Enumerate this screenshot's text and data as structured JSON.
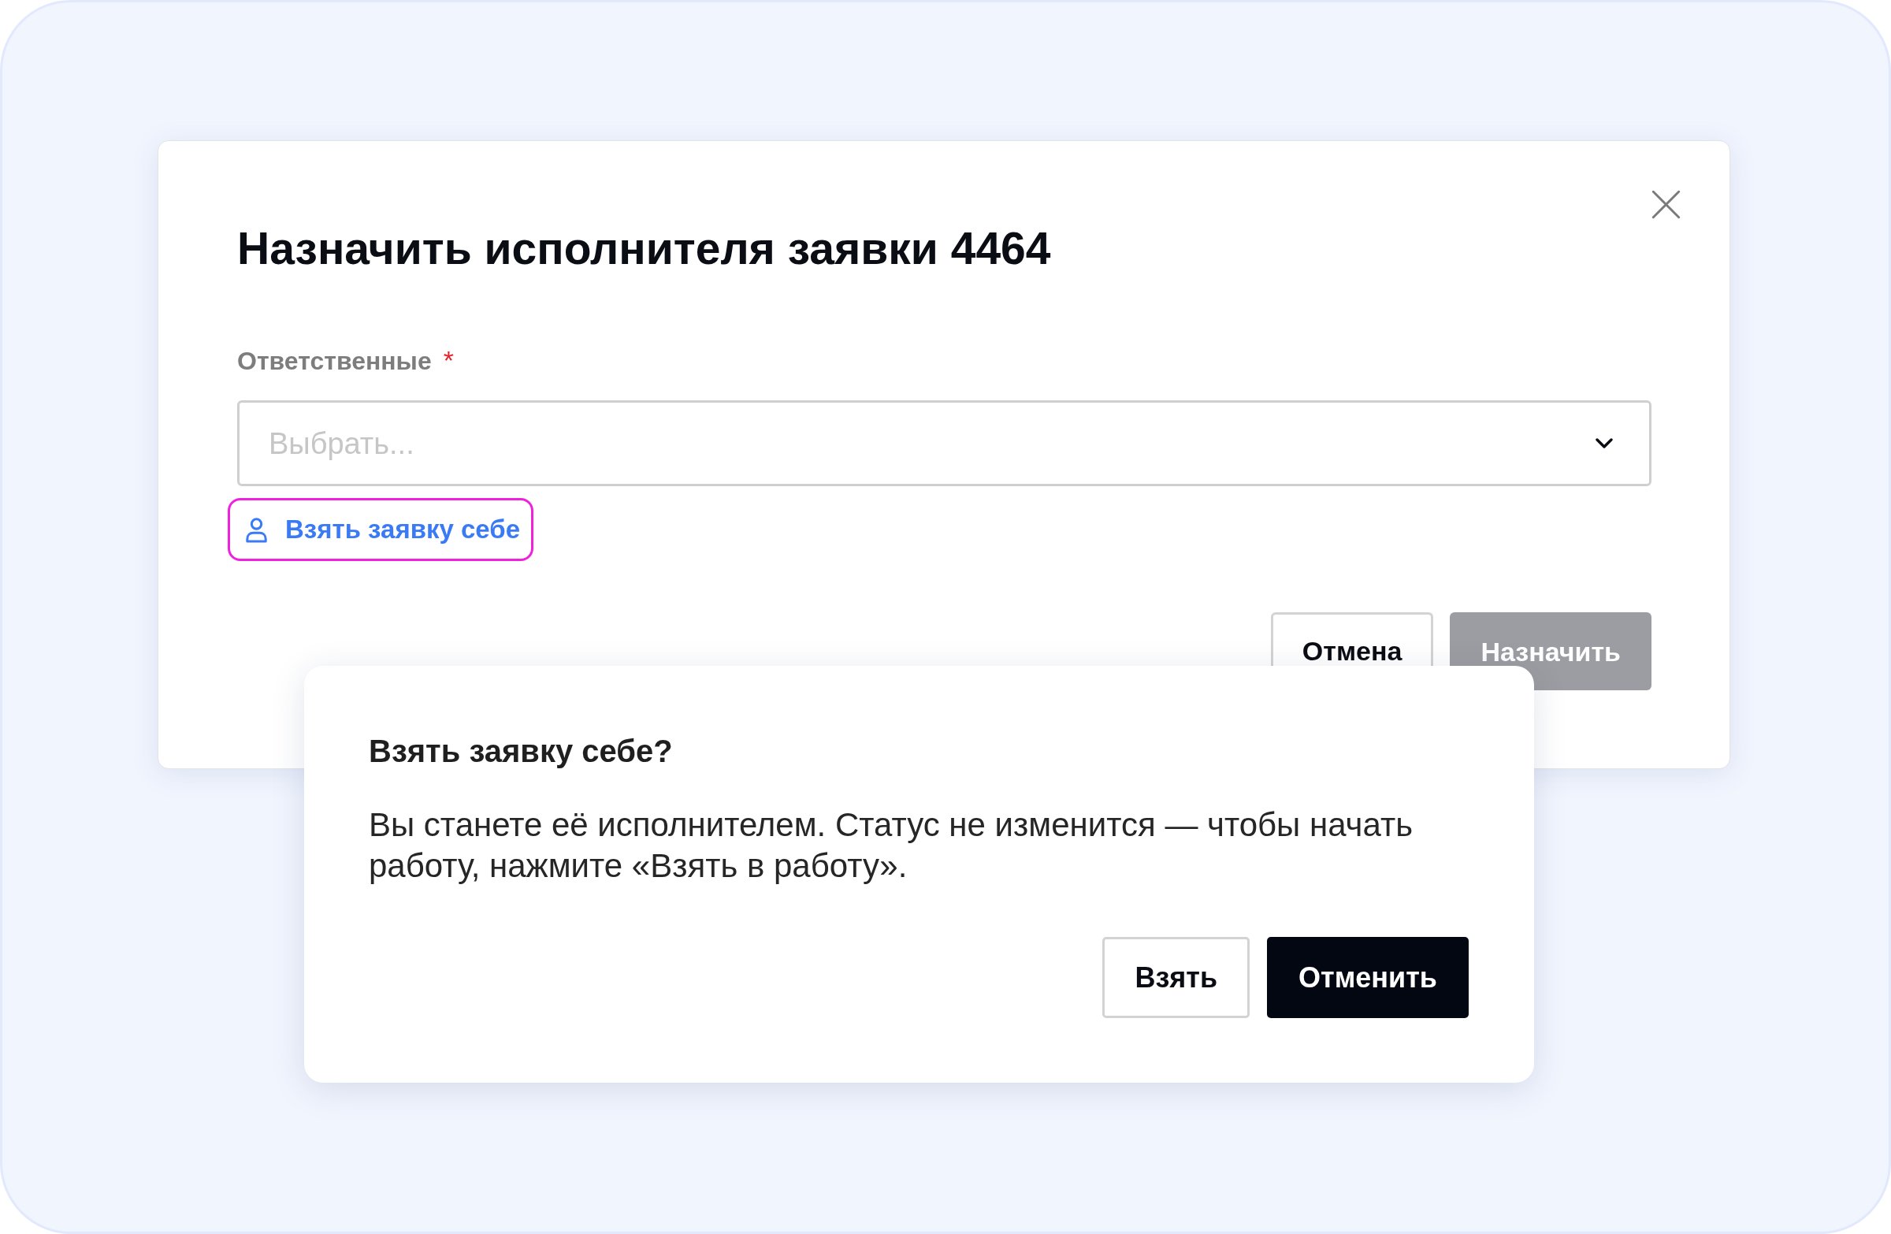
{
  "dialog": {
    "title": "Назначить исполнителя заявки 4464",
    "field": {
      "label": "Ответственные",
      "required_mark": "*",
      "placeholder": "Выбрать..."
    },
    "take_link": {
      "label": "Взять заявку себе",
      "focused": true
    },
    "buttons": [
      {
        "label": "Отмена",
        "kind": "secondary",
        "disabled": false
      },
      {
        "label": "Назначить",
        "kind": "primary",
        "disabled": true
      }
    ]
  },
  "confirm": {
    "title": "Взять заявку себе?",
    "message": "Вы станете её исполнителем. Статус не изменится — чтобы начать работу, нажмите «Взять в работу».",
    "buttons": [
      {
        "label": "Взять",
        "kind": "secondary"
      },
      {
        "label": "Отменить",
        "kind": "primary"
      }
    ]
  }
}
